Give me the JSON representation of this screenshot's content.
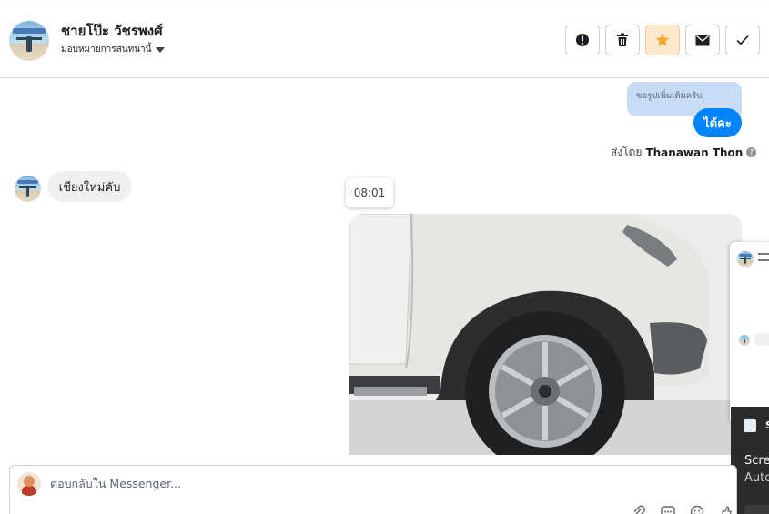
{
  "header": {
    "contact_name": "ชายโป๊ะ วัชรพงศ์",
    "assign_label": "มอบหมายการสนทนานี้",
    "actions": [
      {
        "name": "mark-spam",
        "icon": "alert-icon"
      },
      {
        "name": "delete",
        "icon": "trash-icon"
      },
      {
        "name": "star",
        "icon": "star-icon",
        "color": "#f5a623"
      },
      {
        "name": "unread",
        "icon": "envelope-icon"
      },
      {
        "name": "done",
        "icon": "check-icon"
      }
    ]
  },
  "conversation": {
    "quoted_reply": "ขอรูปเพิ่มเติมครับ",
    "outgoing_message": "ได้คะ",
    "sent_by_prefix": "ส่งโดย",
    "sent_by_name": "Thanawan Thon",
    "incoming_message": "เชียงใหม่คับ",
    "time_label": "08:01",
    "photo_alt": "white SUV front wheel"
  },
  "toast": {
    "title_initial": "S",
    "line1": "Scre",
    "line2": "Auto"
  },
  "composer": {
    "placeholder": "ตอบกลับใน Messenger...",
    "tools": [
      "paperclip-icon",
      "saved-reply-icon",
      "emoji-icon",
      "like-icon"
    ]
  },
  "colors": {
    "accent_blue": "#0084ff",
    "quote_bg": "#c9dcf5",
    "star_orange": "#f5a623"
  }
}
